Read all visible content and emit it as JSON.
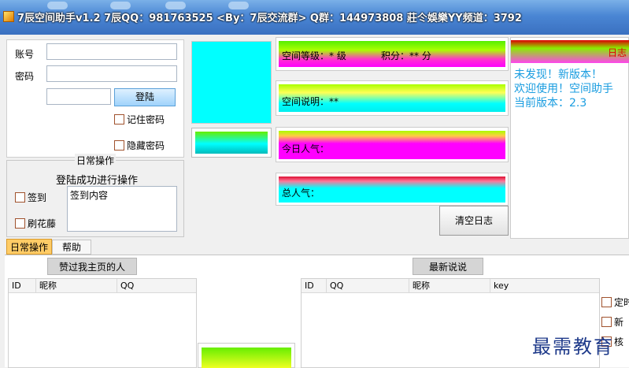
{
  "window": {
    "title": "7辰空间助手v1.2 7辰QQ：981763525 <By：7辰交流群> Q群：144973808 莊仒娛樂YY频道：3792"
  },
  "login": {
    "account_label": "账号",
    "password_label": "密码",
    "account_value": "",
    "password_value": "",
    "captcha_value": "",
    "login_button": "登陆",
    "remember_password": "记住密码",
    "hide_password": "隐藏密码"
  },
  "daily_ops": {
    "group_title": "日常操作",
    "hint": "登陆成功进行操作",
    "signin_label": "签到",
    "signin_content": "签到内容",
    "flowers_label": "刷花藤"
  },
  "stats": {
    "level_text": "空间等级：* 级",
    "points_text": "积分：** 分",
    "description_text": "空间说明：**",
    "today_views_text": "今日人气：",
    "total_views_text": "总人气："
  },
  "log": {
    "title": "日志",
    "lines": [
      "未发现！新版本！",
      "欢迎使用！空间助手",
      "当前版本：2.3"
    ],
    "clear_button": "清空日志"
  },
  "tabs": [
    "日常操作",
    "帮助"
  ],
  "visitors": {
    "button": "赞过我主页的人",
    "columns": [
      "ID",
      "昵称",
      "QQ"
    ]
  },
  "latest": {
    "button": "最新说说",
    "columns": [
      "ID",
      "QQ",
      "昵称",
      "key"
    ]
  },
  "right_options": [
    "定时",
    "新",
    "核"
  ],
  "watermark": "最需教育",
  "colors": {
    "title_bar": "#4a86d4",
    "avatar_fill": "#00ffff",
    "log_title": "#dd0000",
    "log_text": "#1a9de0",
    "accent_magenta": "#ff00ff",
    "accent_green": "#66ee00"
  }
}
